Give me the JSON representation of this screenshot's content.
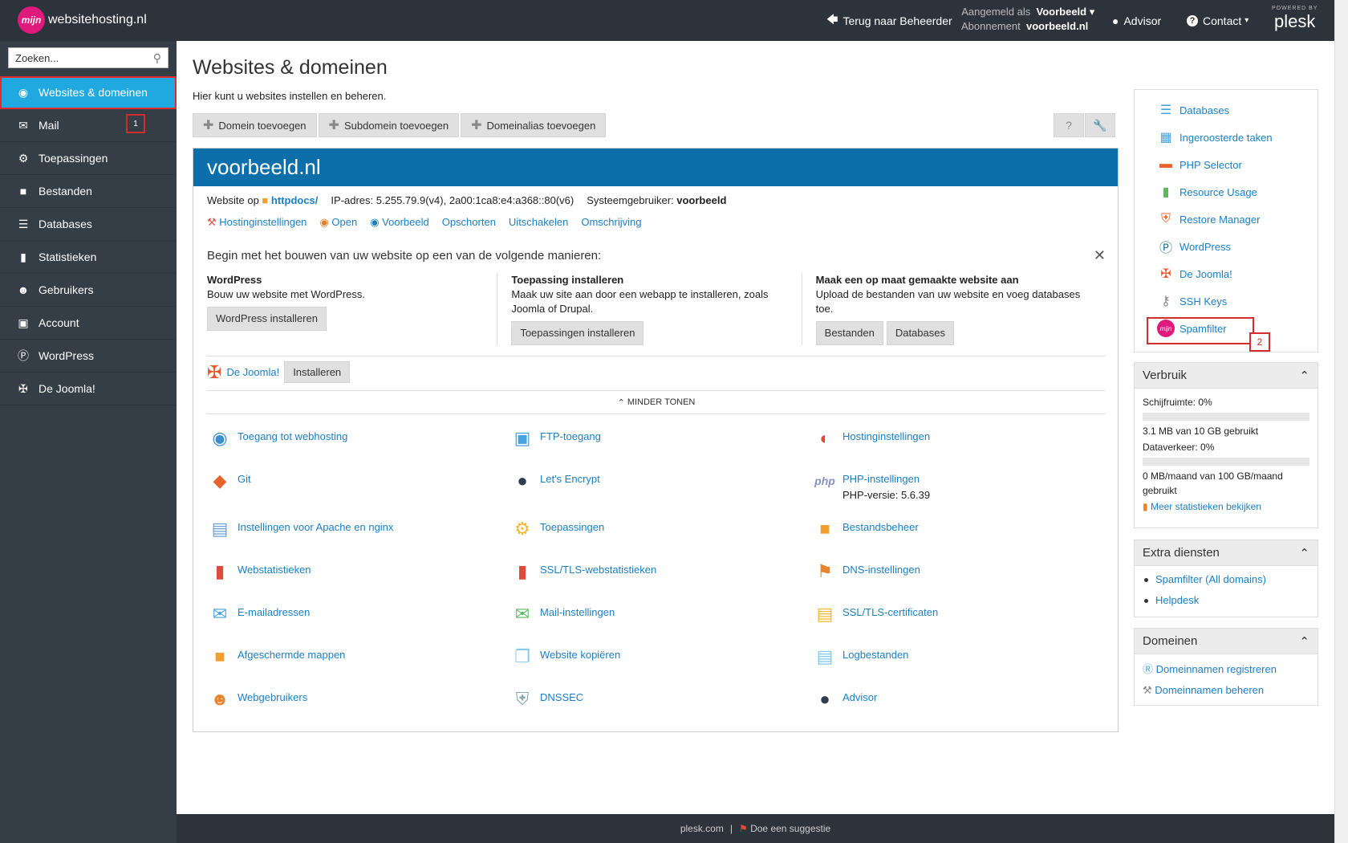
{
  "header": {
    "logo_mark": "mijn",
    "logo_text": "websitehosting.nl",
    "back_link": "Terug naar Beheerder",
    "logged_in_label": "Aangemeld als",
    "logged_in_user": "Voorbeeld",
    "subscription_label": "Abonnement",
    "subscription_value": "voorbeeld.nl",
    "advisor": "Advisor",
    "contact": "Contact",
    "powered_by": "POWERED BY",
    "plesk": "plesk"
  },
  "sidebar": {
    "search_placeholder": "Zoeken...",
    "items": [
      {
        "label": "Websites & domeinen",
        "icon": "globe-icon"
      },
      {
        "label": "Mail",
        "icon": "mail-icon"
      },
      {
        "label": "Toepassingen",
        "icon": "gear-icon"
      },
      {
        "label": "Bestanden",
        "icon": "folder-icon"
      },
      {
        "label": "Databases",
        "icon": "database-icon"
      },
      {
        "label": "Statistieken",
        "icon": "stats-icon"
      },
      {
        "label": "Gebruikers",
        "icon": "user-icon"
      },
      {
        "label": "Account",
        "icon": "account-icon"
      },
      {
        "label": "WordPress",
        "icon": "wordpress-icon"
      },
      {
        "label": "De Joomla!",
        "icon": "joomla-icon"
      }
    ],
    "annotation_1": "1"
  },
  "main": {
    "title": "Websites & domeinen",
    "subtitle": "Hier kunt u websites instellen en beheren.",
    "toolbar": [
      "Domein toevoegen",
      "Subdomein toevoegen",
      "Domeinalias toevoegen"
    ],
    "domain": {
      "name": "voorbeeld.nl",
      "website_on": "Website op",
      "docroot": "httpdocs/",
      "ip_label": "IP-adres:",
      "ip_value": "5.255.79.9(v4), 2a00:1ca8:e4:a368::80(v6)",
      "sysuser_label": "Systeemgebruiker:",
      "sysuser_value": "voorbeeld",
      "links": [
        "Hostinginstellingen",
        "Open",
        "Voorbeeld",
        "Opschorten",
        "Uitschakelen",
        "Omschrijving"
      ]
    },
    "start": {
      "title": "Begin met het bouwen van uw website op een van de volgende manieren:",
      "columns": [
        {
          "heading": "WordPress",
          "text": "Bouw uw website met WordPress.",
          "buttons": [
            "WordPress installeren"
          ]
        },
        {
          "heading": "Toepassing installeren",
          "text": "Maak uw site aan door een webapp te installeren, zoals Joomla of Drupal.",
          "buttons": [
            "Toepassingen installeren"
          ]
        },
        {
          "heading": "Maak een op maat gemaakte website aan",
          "text": "Upload de bestanden van uw website en voeg databases toe.",
          "buttons": [
            "Bestanden",
            "Databases"
          ]
        }
      ]
    },
    "joomla_link": "De Joomla!",
    "joomla_install": "Installeren",
    "less_label": "MINDER TONEN",
    "tiles": [
      [
        "Toegang tot webhosting",
        "FTP-toegang",
        "Hostinginstellingen"
      ],
      [
        "Git",
        "Let's Encrypt",
        "PHP-instellingen"
      ],
      [
        "Instellingen voor Apache en nginx",
        "Toepassingen",
        "Bestandsbeheer"
      ],
      [
        "Webstatistieken",
        "SSL/TLS-webstatistieken",
        "DNS-instellingen"
      ],
      [
        "E-mailadressen",
        "Mail-instellingen",
        "SSL/TLS-certificaten"
      ],
      [
        "Afgeschermde mappen",
        "Website kopiëren",
        "Logbestanden"
      ],
      [
        "Webgebruikers",
        "DNSSEC",
        "Advisor"
      ]
    ],
    "php_version": "PHP-versie: 5.6.39"
  },
  "right": {
    "quick_links": [
      "Databases",
      "Ingeroosterde taken",
      "PHP Selector",
      "Resource Usage",
      "Restore Manager",
      "WordPress",
      "De Joomla!",
      "SSH Keys",
      "Spamfilter"
    ],
    "annotation_2": "2",
    "usage": {
      "title": "Verbruik",
      "disk_label": "Schijfruimte: 0%",
      "disk_detail": "3.1 MB van 10 GB gebruikt",
      "disk_fraction": 0,
      "traffic_label": "Dataverkeer: 0%",
      "traffic_detail": "0 MB/maand van 100 GB/maand gebruikt",
      "traffic_fraction": 0,
      "more": "Meer statistieken bekijken"
    },
    "extra": {
      "title": "Extra diensten",
      "items": [
        "Spamfilter (All domains)",
        "Helpdesk"
      ]
    },
    "domains": {
      "title": "Domeinen",
      "items": [
        "Domeinnamen registreren",
        "Domeinnamen beheren"
      ]
    }
  },
  "footer": {
    "link": "plesk.com",
    "sep": "|",
    "suggest": "Doe een suggestie"
  },
  "colors": {
    "topbar": "#2d333b",
    "sidebar": "#353d47",
    "active": "#20a8e0",
    "domain_header": "#0d6faa",
    "link": "#1b7fc4",
    "annotation": "#d12d2d"
  }
}
